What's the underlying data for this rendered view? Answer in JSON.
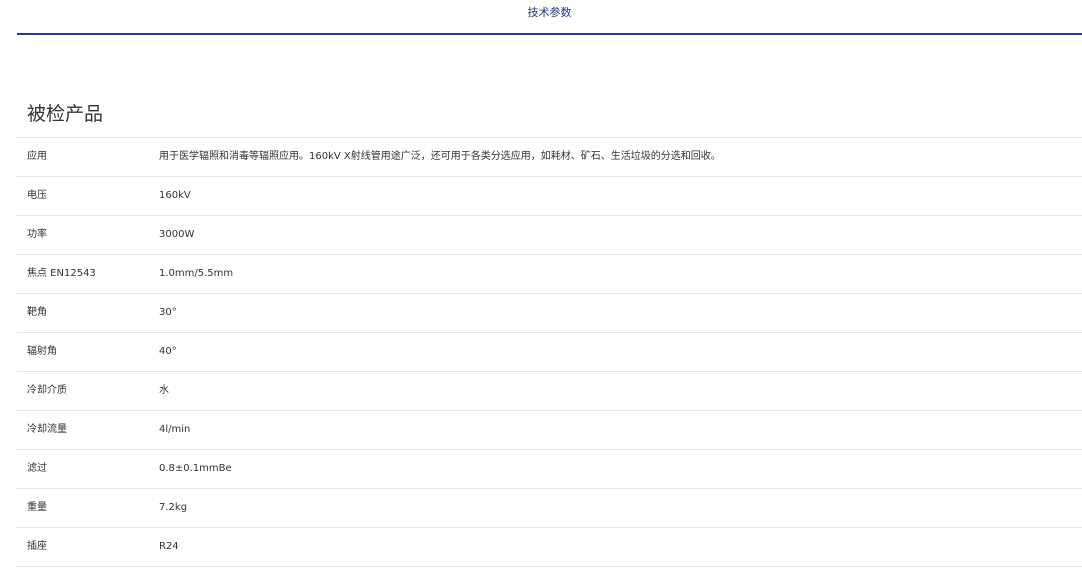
{
  "tabs": {
    "active_label": "技术参数"
  },
  "section": {
    "title": "被检产品"
  },
  "specs": [
    {
      "label": "应用",
      "value": "用于医学辐照和消毒等辐照应用。160kV X射线管用途广泛，还可用于各类分选应用，如耗材、矿石、生活垃圾的分选和回收。"
    },
    {
      "label": "电压",
      "value": "160kV"
    },
    {
      "label": "功率",
      "value": "3000W"
    },
    {
      "label": "焦点 EN12543",
      "value": "1.0mm/5.5mm"
    },
    {
      "label": "靶角",
      "value": "30°"
    },
    {
      "label": "辐射角",
      "value": "40°"
    },
    {
      "label": "冷却介质",
      "value": "水"
    },
    {
      "label": "冷却流量",
      "value": "4l/min"
    },
    {
      "label": "滤过",
      "value": "0.8±0.1mmBe"
    },
    {
      "label": "重量",
      "value": "7.2kg"
    },
    {
      "label": "插座",
      "value": "R24"
    }
  ]
}
